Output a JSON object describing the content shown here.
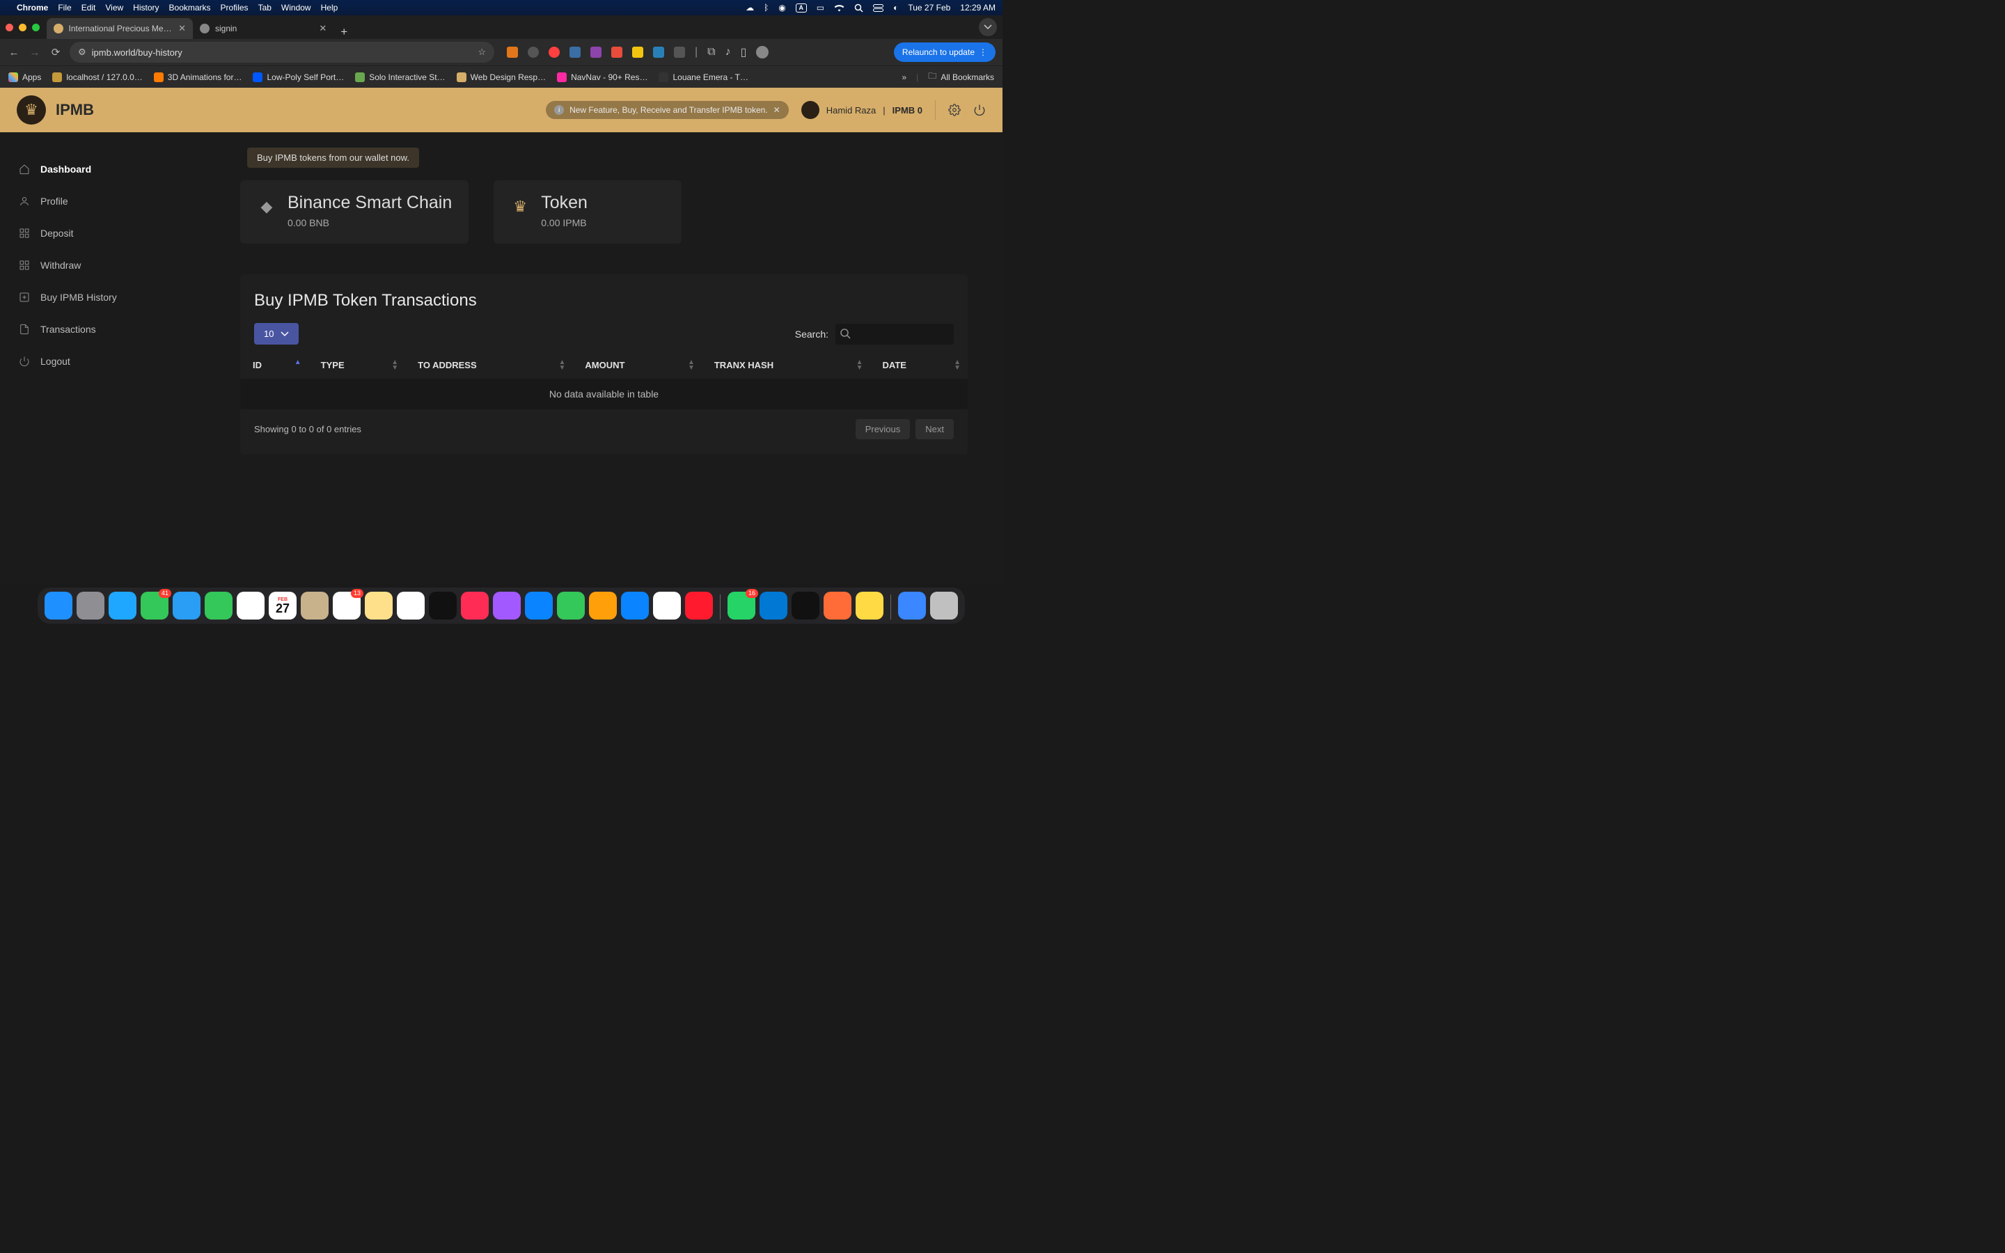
{
  "menubar": {
    "app": "Chrome",
    "items": [
      "File",
      "Edit",
      "View",
      "History",
      "Bookmarks",
      "Profiles",
      "Tab",
      "Window",
      "Help"
    ],
    "right": {
      "a_box": "A",
      "date": "Tue 27 Feb",
      "time": "12:29 AM"
    }
  },
  "chrome": {
    "tabs": [
      {
        "title": "International Precious Metals",
        "active": true
      },
      {
        "title": "signin",
        "active": false
      }
    ],
    "url": "ipmb.world/buy-history",
    "relaunch": "Relaunch to update",
    "bookmarks": {
      "items": [
        "Apps",
        "localhost / 127.0.0…",
        "3D Animations for…",
        "Low-Poly Self Port…",
        "Solo Interactive St…",
        "Web Design Resp…",
        "NavNav - 90+ Res…",
        "Louane Emera - T…"
      ],
      "all": "All Bookmarks"
    }
  },
  "ipmb": {
    "brand": "IPMB",
    "feature_banner": "New Feature, Buy, Receive and Transfer IPMB token.",
    "user": {
      "name": "Hamid Raza",
      "sep": "|",
      "balance_label": "IPMB 0"
    },
    "sidebar": [
      {
        "label": "Dashboard",
        "icon": "home",
        "active": true
      },
      {
        "label": "Profile",
        "icon": "user"
      },
      {
        "label": "Deposit",
        "icon": "grid"
      },
      {
        "label": "Withdraw",
        "icon": "grid"
      },
      {
        "label": "Buy IPMB History",
        "icon": "plus-square"
      },
      {
        "label": "Transactions",
        "icon": "file"
      },
      {
        "label": "Logout",
        "icon": "power"
      }
    ],
    "buy_pill": "Buy IPMB tokens from our wallet now.",
    "cards": [
      {
        "title": "Binance Smart Chain",
        "sub": "0.00 BNB",
        "icon": "eth"
      },
      {
        "title": "Token",
        "sub": "0.00 IPMB",
        "icon": "lion"
      }
    ],
    "table": {
      "title": "Buy IPMB Token Transactions",
      "page_size": "10",
      "search_label": "Search:",
      "columns": [
        "ID",
        "TYPE",
        "TO ADDRESS",
        "AMOUNT",
        "TRANX HASH",
        "DATE"
      ],
      "empty": "No data available in table",
      "showing": "Showing 0 to 0 of 0 entries",
      "prev": "Previous",
      "next": "Next"
    }
  },
  "dock": {
    "apps": [
      {
        "name": "finder",
        "bg": "#1e90ff"
      },
      {
        "name": "launchpad",
        "bg": "#8e8e93"
      },
      {
        "name": "safari",
        "bg": "#1fa7ff"
      },
      {
        "name": "messages",
        "bg": "#34c759",
        "badge": "41"
      },
      {
        "name": "mail",
        "bg": "#2a9df4"
      },
      {
        "name": "facetime",
        "bg": "#34c759"
      },
      {
        "name": "photos",
        "bg": "#ffffff"
      },
      {
        "name": "calendar",
        "bg": "#ffffff",
        "text": "27",
        "sub": "FEB"
      },
      {
        "name": "contacts",
        "bg": "#c8b28b"
      },
      {
        "name": "reminders",
        "bg": "#ffffff",
        "badge": "13"
      },
      {
        "name": "notes",
        "bg": "#ffe08a"
      },
      {
        "name": "freeform",
        "bg": "#ffffff"
      },
      {
        "name": "appletv",
        "bg": "#111"
      },
      {
        "name": "music",
        "bg": "#ff2d55"
      },
      {
        "name": "podcasts",
        "bg": "#a259ff"
      },
      {
        "name": "appstore",
        "bg": "#0a84ff"
      },
      {
        "name": "numbers",
        "bg": "#34c759"
      },
      {
        "name": "pages",
        "bg": "#ff9f0a"
      },
      {
        "name": "app-store-2",
        "bg": "#0a84ff"
      },
      {
        "name": "chrome",
        "bg": "#fff"
      },
      {
        "name": "opera",
        "bg": "#ff1b2d"
      }
    ],
    "apps2": [
      {
        "name": "whatsapp",
        "bg": "#25d366",
        "badge": "16"
      },
      {
        "name": "vscode",
        "bg": "#0078d4"
      },
      {
        "name": "terminal",
        "bg": "#111"
      },
      {
        "name": "postman",
        "bg": "#ff6c37"
      },
      {
        "name": "mail2",
        "bg": "#ffda44"
      }
    ],
    "apps3": [
      {
        "name": "downloads",
        "bg": "#3a87ff"
      },
      {
        "name": "trash",
        "bg": "#c0c0c0"
      }
    ]
  }
}
